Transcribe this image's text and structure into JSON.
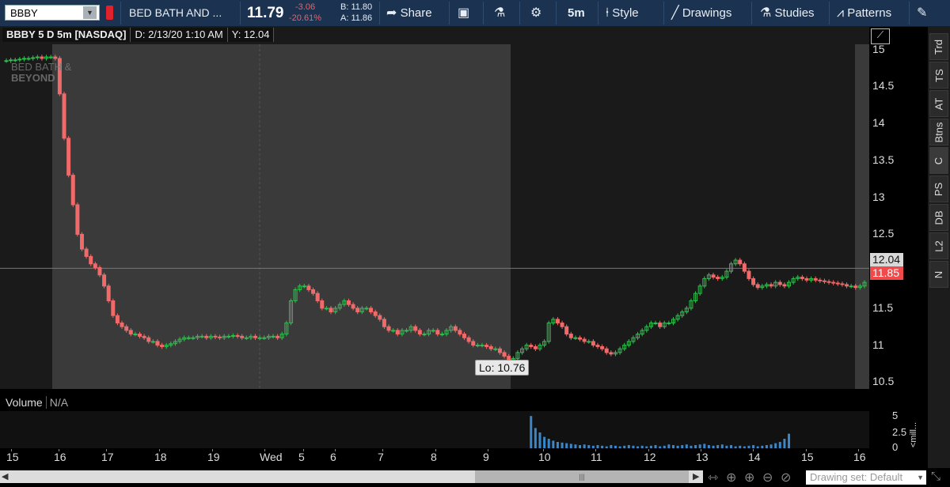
{
  "toolbar": {
    "symbol": "BBBY",
    "description": "BED BATH AND ...",
    "last_price": "11.79",
    "net_change": "-3.06",
    "pct_change": "-20.61%",
    "bid": "B: 11.80",
    "ask": "A: 11.86",
    "share_label": "Share",
    "timeframe_label": "5m",
    "style_label": "Style",
    "drawings_label": "Drawings",
    "studies_label": "Studies",
    "patterns_label": "Patterns"
  },
  "chart_header": {
    "title": "BBBY 5 D 5m [NASDAQ]",
    "date": "D: 2/13/20 1:10 AM",
    "y_value": "Y: 12.04"
  },
  "watermark": {
    "line1": "BED BATH &",
    "line2": "BEYOND"
  },
  "price_axis": {
    "labels": [
      "15",
      "14.5",
      "14",
      "13.5",
      "13",
      "12.5",
      "12",
      "11.5",
      "11",
      "10.5"
    ]
  },
  "price_tags": {
    "crosshair": "12.04",
    "last": "11.85"
  },
  "low_marker": "Lo: 10.76",
  "volume": {
    "label": "Volume",
    "value": "N/A",
    "axis_labels": [
      "5",
      "2.5",
      "0"
    ],
    "unit": "<mill..."
  },
  "time_axis": {
    "labels": [
      "15",
      "16",
      "17",
      "18",
      "19",
      "Wed",
      "5",
      "6",
      "7",
      "8",
      "9",
      "10",
      "11",
      "12",
      "13",
      "14",
      "15",
      "16"
    ]
  },
  "right_tabs": [
    "Trd",
    "TS",
    "AT",
    "Btns",
    "C",
    "PS",
    "DB",
    "L2",
    "N"
  ],
  "footer": {
    "drawing_set": "Drawing set: Default"
  },
  "colors": {
    "up": "#2fbf4f",
    "down": "#f06a6a",
    "toolbar": "#1b3350",
    "extended_hours": "#3a3a3a"
  },
  "chart_data": {
    "type": "candlestick",
    "ylim": [
      10.3,
      15.2
    ],
    "closes": [
      14.85,
      14.86,
      14.86,
      14.87,
      14.88,
      14.88,
      14.89,
      14.9,
      14.88,
      14.9,
      14.9,
      14.88,
      14.4,
      13.8,
      13.3,
      12.9,
      12.5,
      12.3,
      12.2,
      12.1,
      12.05,
      11.95,
      11.8,
      11.6,
      11.4,
      11.3,
      11.25,
      11.2,
      11.15,
      11.15,
      11.12,
      11.1,
      11.05,
      11.05,
      11.0,
      10.98,
      11.0,
      11.02,
      11.05,
      11.08,
      11.1,
      11.1,
      11.1,
      11.12,
      11.12,
      11.1,
      11.12,
      11.11,
      11.1,
      11.12,
      11.12,
      11.13,
      11.12,
      11.1,
      11.1,
      11.12,
      11.1,
      11.1,
      11.1,
      11.12,
      11.12,
      11.1,
      11.15,
      11.3,
      11.6,
      11.75,
      11.8,
      11.8,
      11.75,
      11.7,
      11.6,
      11.5,
      11.5,
      11.45,
      11.5,
      11.55,
      11.6,
      11.55,
      11.5,
      11.45,
      11.5,
      11.5,
      11.45,
      11.4,
      11.35,
      11.25,
      11.2,
      11.2,
      11.15,
      11.2,
      11.2,
      11.25,
      11.2,
      11.15,
      11.15,
      11.2,
      11.2,
      11.15,
      11.15,
      11.2,
      11.25,
      11.2,
      11.15,
      11.1,
      11.05,
      11.0,
      11.0,
      11.0,
      10.98,
      10.95,
      10.95,
      10.9,
      10.85,
      10.8,
      10.82,
      10.9,
      10.95,
      11.0,
      10.98,
      10.95,
      11.0,
      11.05,
      11.3,
      11.35,
      11.3,
      11.25,
      11.15,
      11.1,
      11.1,
      11.08,
      11.05,
      11.05,
      11.0,
      10.98,
      10.95,
      10.9,
      10.88,
      10.9,
      10.95,
      11.0,
      11.05,
      11.1,
      11.15,
      11.2,
      11.25,
      11.3,
      11.3,
      11.25,
      11.3,
      11.3,
      11.35,
      11.4,
      11.45,
      11.5,
      11.6,
      11.7,
      11.8,
      11.9,
      11.95,
      11.92,
      11.9,
      11.92,
      12.0,
      12.1,
      12.15,
      12.1,
      12.0,
      11.9,
      11.82,
      11.78,
      11.8,
      11.82,
      11.8,
      11.85,
      11.82,
      11.8,
      11.85,
      11.9,
      11.92,
      11.9,
      11.88,
      11.9,
      11.88,
      11.87,
      11.86,
      11.85,
      11.84,
      11.83,
      11.82,
      11.8,
      11.8,
      11.78,
      11.8,
      11.85
    ],
    "session_lows": {
      "min": 10.76,
      "min_label": "Lo: 10.76"
    },
    "volume_bars": [
      0,
      0,
      0,
      0,
      0,
      0,
      0,
      0,
      0,
      0,
      0,
      0,
      0,
      0,
      0,
      0,
      0,
      0,
      0,
      0,
      0,
      0,
      0,
      0,
      0,
      0,
      0,
      0,
      0,
      0,
      0,
      0,
      0,
      0,
      0,
      0,
      0,
      0,
      0,
      0,
      0,
      0,
      0,
      0,
      0,
      0,
      0,
      0,
      0,
      0,
      0,
      0,
      0,
      0,
      0,
      0,
      0,
      0,
      0,
      0,
      0,
      0,
      0,
      0,
      0,
      0,
      0,
      0,
      0,
      0,
      0,
      0,
      0,
      0,
      0,
      0,
      0,
      0,
      0,
      0,
      0,
      0,
      0,
      0,
      0,
      0,
      0,
      0,
      0,
      0,
      0,
      0,
      0,
      0,
      0,
      0,
      0,
      0,
      0,
      0,
      0,
      0,
      0,
      0,
      0,
      0,
      0,
      0,
      0,
      0,
      0,
      0,
      0,
      0,
      0,
      0,
      0,
      0,
      5.1,
      3.2,
      2.5,
      1.8,
      1.5,
      1.2,
      1.0,
      0.9,
      0.8,
      0.7,
      0.6,
      0.5,
      0.6,
      0.5,
      0.4,
      0.5,
      0.4,
      0.3,
      0.5,
      0.4,
      0.3,
      0.4,
      0.5,
      0.4,
      0.3,
      0.4,
      0.3,
      0.4,
      0.5,
      0.3,
      0.4,
      0.6,
      0.5,
      0.4,
      0.5,
      0.6,
      0.4,
      0.5,
      0.6,
      0.7,
      0.5,
      0.4,
      0.5,
      0.6,
      0.4,
      0.5,
      0.3,
      0.4,
      0.3,
      0.4,
      0.5,
      0.3,
      0.4,
      0.5,
      0.6,
      0.8,
      1.0,
      1.5,
      2.3
    ]
  }
}
